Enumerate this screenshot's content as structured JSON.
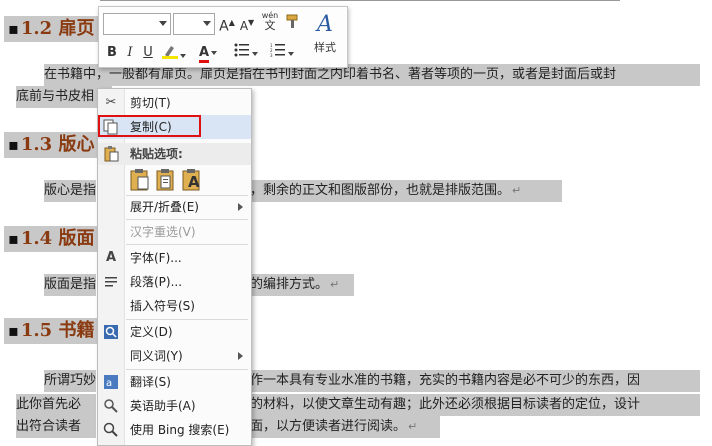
{
  "document": {
    "headings": [
      {
        "num": "1.2",
        "text": "扉页"
      },
      {
        "num": "1.3",
        "text": "版心"
      },
      {
        "num": "1.4",
        "text": "版面"
      },
      {
        "num": "1.5",
        "text": "书籍"
      }
    ],
    "para1_line1": "在书籍中，一般都有扉页。扉页是指在书刊封面之内印着书名、著者等项的一页，或者是封面后或封",
    "para1_line2": "底前与书皮相",
    "para2_start": "版心是指",
    "para2_end": "，剩余的正文和图版部份，也就是排版范围。",
    "para3_start": "版面是指",
    "para3_end": "的编排方式。",
    "para4_line1_start": "所谓巧妙",
    "para4_line1_end": "作一本具有专业水准的书籍，充实的书籍内容是必不可少的东西，因",
    "para4_line2_start": "此你首先必",
    "para4_line2_end": "的材料，以使文章生动有趣；此外还必须根据目标读者的定位，设计",
    "para4_line3_start": "出符合读者",
    "para4_line3_end": "面，以方便读者进行阅读。",
    "para_mark": "↵"
  },
  "mini_toolbar": {
    "font_name": "",
    "font_size": "",
    "grow_font": "A",
    "shrink_font": "A",
    "phonetic": "wén",
    "bold": "B",
    "italic": "I",
    "underline": "U",
    "font_color_letter": "A",
    "style_letter": "A",
    "style_label": "样式"
  },
  "context_menu": {
    "cut": "剪切(T)",
    "copy": "复制(C)",
    "paste_options": "粘贴选项:",
    "expand_collapse": "展开/折叠(E)",
    "reconvert": "汉字重选(V)",
    "font": "字体(F)...",
    "paragraph": "段落(P)...",
    "insert_symbol": "插入符号(S)",
    "define": "定义(D)",
    "synonyms": "同义词(Y)",
    "translate": "翻译(S)",
    "english_assistant": "英语助手(A)",
    "bing_search": "使用 Bing 搜索(E)",
    "paste_keep_text": "A"
  },
  "colors": {
    "heading": "#8a3a10",
    "selection": "#c8c8c8",
    "highlight_red": "#e01010",
    "menu_hover": "#d9e5f5"
  }
}
